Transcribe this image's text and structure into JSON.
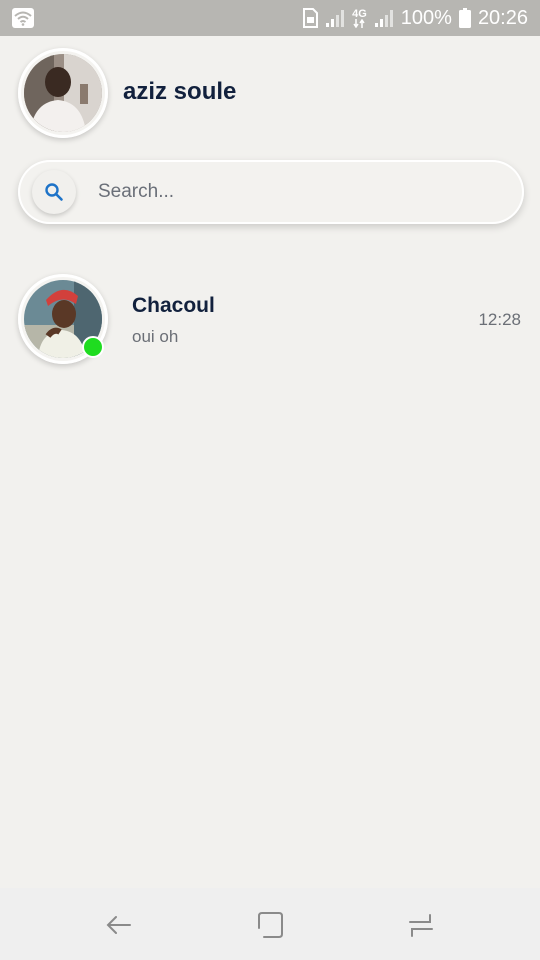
{
  "status_bar": {
    "battery_percent": "100%",
    "time": "20:26",
    "network_label": "4G",
    "icons": [
      "wifi-icon",
      "sim-icon",
      "signal-icon",
      "network-4g-icon",
      "signal-icon",
      "battery-icon"
    ]
  },
  "profile": {
    "name": "aziz soule",
    "avatar_icon": "user-avatar-photo"
  },
  "search": {
    "placeholder": "Search...",
    "value": "",
    "icon": "search-icon"
  },
  "chats": [
    {
      "name": "Chacoul",
      "preview": "oui oh",
      "time": "12:28",
      "online": true,
      "avatar_icon": "contact-avatar-photo"
    }
  ],
  "nav_bar": {
    "icons": [
      "back-icon",
      "home-icon",
      "recent-apps-icon"
    ]
  },
  "colors": {
    "background": "#f2f1ee",
    "status_bar": "#b7b6b2",
    "name_text": "#12213d",
    "secondary_text": "#6b6f76",
    "online_indicator": "#1fdc20",
    "search_icon": "#1e73c8"
  }
}
